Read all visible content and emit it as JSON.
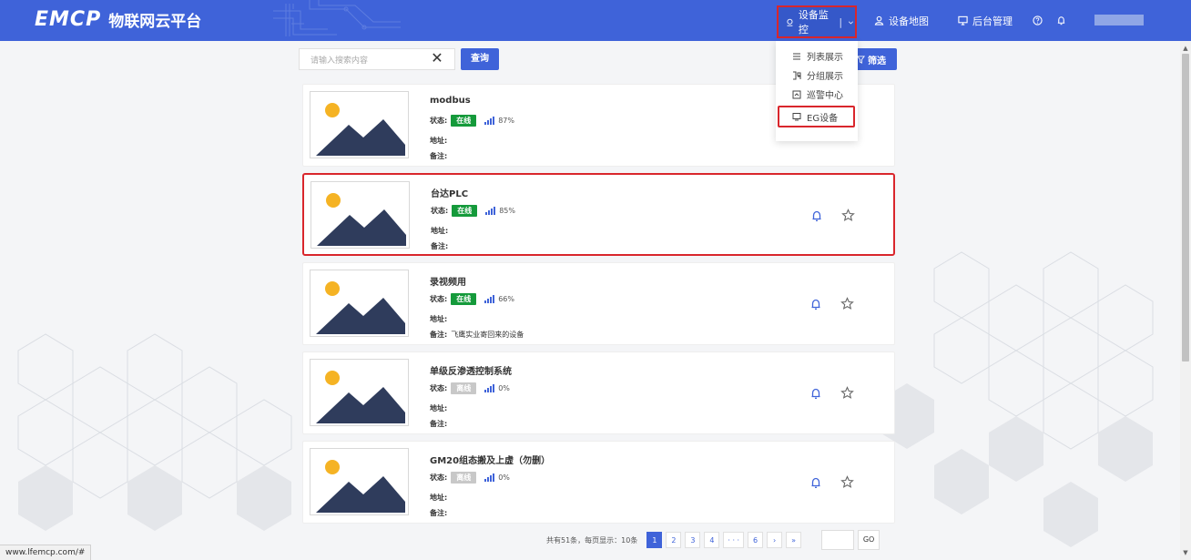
{
  "header": {
    "brand": "EMCP",
    "platform_title": "物联网云平台",
    "nav": {
      "monitor": "设备监控",
      "map": "设备地图",
      "admin": "后台管理"
    }
  },
  "dropdown": {
    "items": [
      {
        "label": "列表展示",
        "icon": "list-icon"
      },
      {
        "label": "分组展示",
        "icon": "group-icon"
      },
      {
        "label": "巡警中心",
        "icon": "alarm-center-icon"
      },
      {
        "label": "EG设备",
        "icon": "device-icon"
      }
    ]
  },
  "search": {
    "placeholder": "请输入搜索内容",
    "clear": "✕",
    "query_button": "查询",
    "filter_button": "筛选"
  },
  "labels": {
    "status": "状态:",
    "address": "地址:",
    "note": "备注:"
  },
  "devices": [
    {
      "name": "modbus",
      "status": "在线",
      "online": true,
      "signal": "87%",
      "address": "",
      "note": ""
    },
    {
      "name": "台达PLC",
      "status": "在线",
      "online": true,
      "signal": "85%",
      "address": "",
      "note": ""
    },
    {
      "name": "录视频用",
      "status": "在线",
      "online": true,
      "signal": "66%",
      "address": "",
      "note": "飞鹰实业寄回来的设备"
    },
    {
      "name": "单级反渗透控制系统",
      "status": "离线",
      "online": false,
      "signal": "0%",
      "address": "",
      "note": ""
    },
    {
      "name": "GM20组态搬及上虚（勿删）",
      "status": "离线",
      "online": false,
      "signal": "0%",
      "address": "",
      "note": ""
    }
  ],
  "pagination": {
    "summary": "共有51条，每页显示：10条",
    "pages": [
      "1",
      "2",
      "3",
      "4",
      "· · ·",
      "6",
      "›",
      "»"
    ],
    "current": "1",
    "go": "GO"
  },
  "status_url": "www.lfemcp.com/#",
  "colors": {
    "primary": "#3f63d9",
    "online": "#159a3b",
    "offline": "#c8c8c8",
    "highlight": "#d9262c",
    "thumb_sun": "#f5b324",
    "thumb_mountain": "#2f3c5c"
  }
}
